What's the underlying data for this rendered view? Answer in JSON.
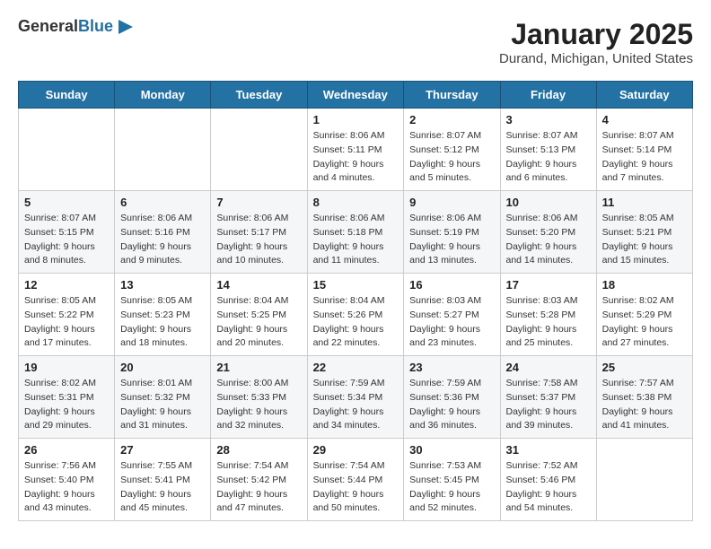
{
  "header": {
    "logo_general": "General",
    "logo_blue": "Blue",
    "title": "January 2025",
    "subtitle": "Durand, Michigan, United States"
  },
  "weekdays": [
    "Sunday",
    "Monday",
    "Tuesday",
    "Wednesday",
    "Thursday",
    "Friday",
    "Saturday"
  ],
  "weeks": [
    [
      {
        "day": "",
        "info": ""
      },
      {
        "day": "",
        "info": ""
      },
      {
        "day": "",
        "info": ""
      },
      {
        "day": "1",
        "info": "Sunrise: 8:06 AM\nSunset: 5:11 PM\nDaylight: 9 hours and 4 minutes."
      },
      {
        "day": "2",
        "info": "Sunrise: 8:07 AM\nSunset: 5:12 PM\nDaylight: 9 hours and 5 minutes."
      },
      {
        "day": "3",
        "info": "Sunrise: 8:07 AM\nSunset: 5:13 PM\nDaylight: 9 hours and 6 minutes."
      },
      {
        "day": "4",
        "info": "Sunrise: 8:07 AM\nSunset: 5:14 PM\nDaylight: 9 hours and 7 minutes."
      }
    ],
    [
      {
        "day": "5",
        "info": "Sunrise: 8:07 AM\nSunset: 5:15 PM\nDaylight: 9 hours and 8 minutes."
      },
      {
        "day": "6",
        "info": "Sunrise: 8:06 AM\nSunset: 5:16 PM\nDaylight: 9 hours and 9 minutes."
      },
      {
        "day": "7",
        "info": "Sunrise: 8:06 AM\nSunset: 5:17 PM\nDaylight: 9 hours and 10 minutes."
      },
      {
        "day": "8",
        "info": "Sunrise: 8:06 AM\nSunset: 5:18 PM\nDaylight: 9 hours and 11 minutes."
      },
      {
        "day": "9",
        "info": "Sunrise: 8:06 AM\nSunset: 5:19 PM\nDaylight: 9 hours and 13 minutes."
      },
      {
        "day": "10",
        "info": "Sunrise: 8:06 AM\nSunset: 5:20 PM\nDaylight: 9 hours and 14 minutes."
      },
      {
        "day": "11",
        "info": "Sunrise: 8:05 AM\nSunset: 5:21 PM\nDaylight: 9 hours and 15 minutes."
      }
    ],
    [
      {
        "day": "12",
        "info": "Sunrise: 8:05 AM\nSunset: 5:22 PM\nDaylight: 9 hours and 17 minutes."
      },
      {
        "day": "13",
        "info": "Sunrise: 8:05 AM\nSunset: 5:23 PM\nDaylight: 9 hours and 18 minutes."
      },
      {
        "day": "14",
        "info": "Sunrise: 8:04 AM\nSunset: 5:25 PM\nDaylight: 9 hours and 20 minutes."
      },
      {
        "day": "15",
        "info": "Sunrise: 8:04 AM\nSunset: 5:26 PM\nDaylight: 9 hours and 22 minutes."
      },
      {
        "day": "16",
        "info": "Sunrise: 8:03 AM\nSunset: 5:27 PM\nDaylight: 9 hours and 23 minutes."
      },
      {
        "day": "17",
        "info": "Sunrise: 8:03 AM\nSunset: 5:28 PM\nDaylight: 9 hours and 25 minutes."
      },
      {
        "day": "18",
        "info": "Sunrise: 8:02 AM\nSunset: 5:29 PM\nDaylight: 9 hours and 27 minutes."
      }
    ],
    [
      {
        "day": "19",
        "info": "Sunrise: 8:02 AM\nSunset: 5:31 PM\nDaylight: 9 hours and 29 minutes."
      },
      {
        "day": "20",
        "info": "Sunrise: 8:01 AM\nSunset: 5:32 PM\nDaylight: 9 hours and 31 minutes."
      },
      {
        "day": "21",
        "info": "Sunrise: 8:00 AM\nSunset: 5:33 PM\nDaylight: 9 hours and 32 minutes."
      },
      {
        "day": "22",
        "info": "Sunrise: 7:59 AM\nSunset: 5:34 PM\nDaylight: 9 hours and 34 minutes."
      },
      {
        "day": "23",
        "info": "Sunrise: 7:59 AM\nSunset: 5:36 PM\nDaylight: 9 hours and 36 minutes."
      },
      {
        "day": "24",
        "info": "Sunrise: 7:58 AM\nSunset: 5:37 PM\nDaylight: 9 hours and 39 minutes."
      },
      {
        "day": "25",
        "info": "Sunrise: 7:57 AM\nSunset: 5:38 PM\nDaylight: 9 hours and 41 minutes."
      }
    ],
    [
      {
        "day": "26",
        "info": "Sunrise: 7:56 AM\nSunset: 5:40 PM\nDaylight: 9 hours and 43 minutes."
      },
      {
        "day": "27",
        "info": "Sunrise: 7:55 AM\nSunset: 5:41 PM\nDaylight: 9 hours and 45 minutes."
      },
      {
        "day": "28",
        "info": "Sunrise: 7:54 AM\nSunset: 5:42 PM\nDaylight: 9 hours and 47 minutes."
      },
      {
        "day": "29",
        "info": "Sunrise: 7:54 AM\nSunset: 5:44 PM\nDaylight: 9 hours and 50 minutes."
      },
      {
        "day": "30",
        "info": "Sunrise: 7:53 AM\nSunset: 5:45 PM\nDaylight: 9 hours and 52 minutes."
      },
      {
        "day": "31",
        "info": "Sunrise: 7:52 AM\nSunset: 5:46 PM\nDaylight: 9 hours and 54 minutes."
      },
      {
        "day": "",
        "info": ""
      }
    ]
  ]
}
